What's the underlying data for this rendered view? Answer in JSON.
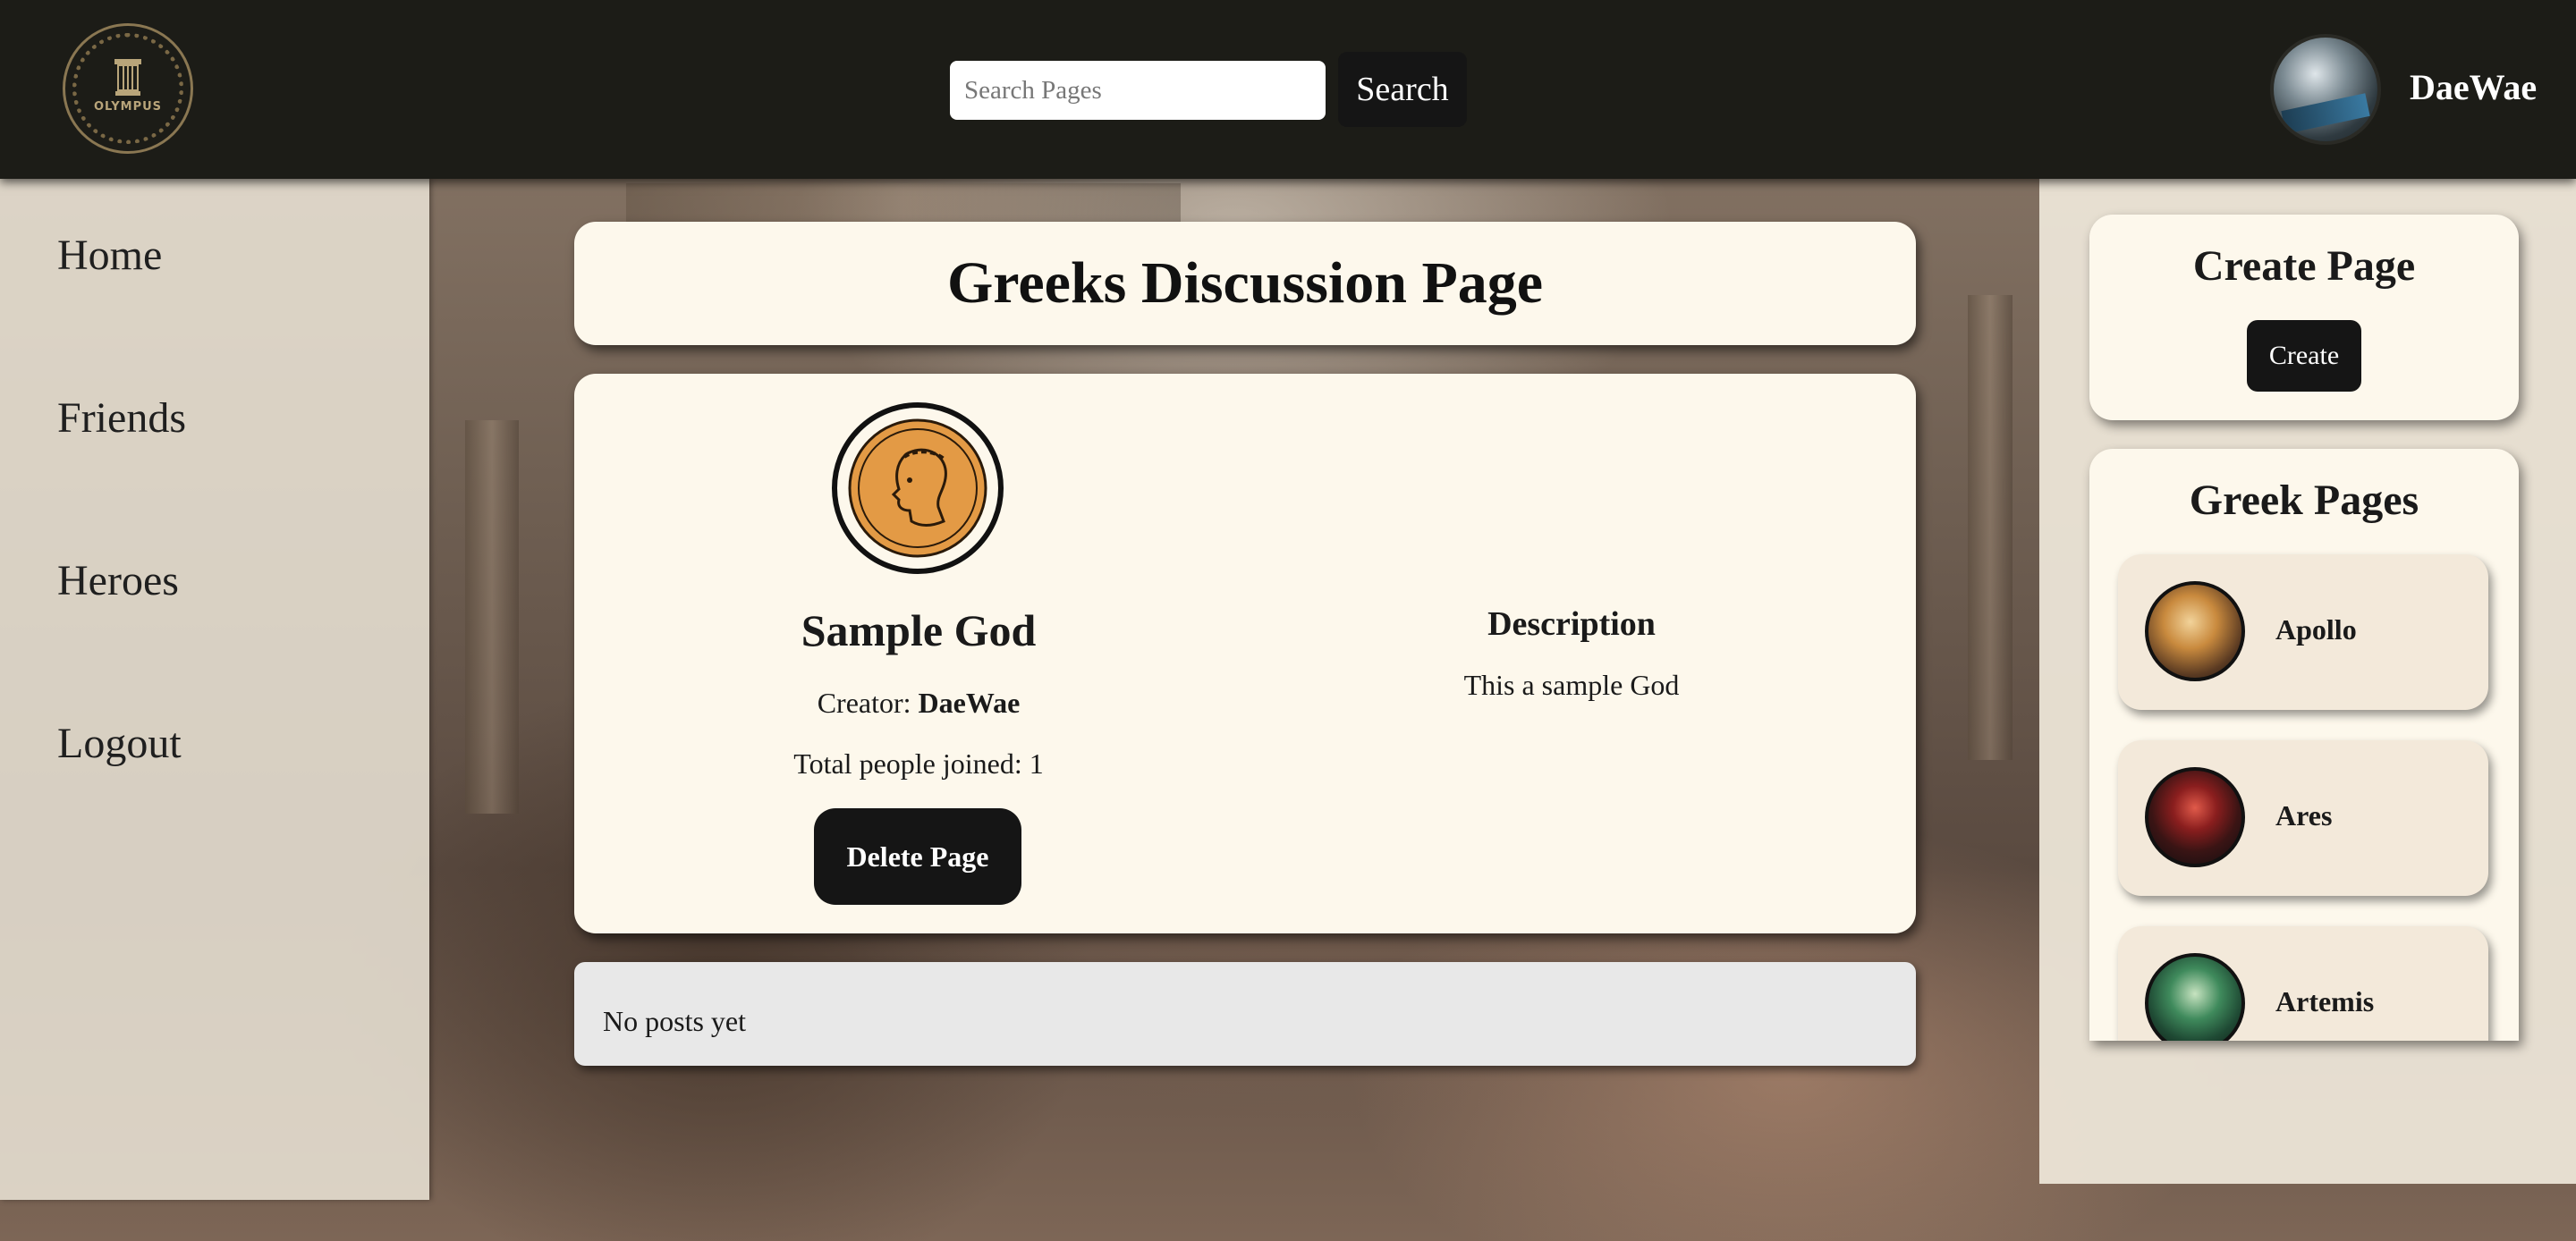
{
  "header": {
    "logo_text": "OLYMPUS",
    "search_placeholder": "Search Pages",
    "search_button": "Search",
    "username": "DaeWae"
  },
  "nav": {
    "items": [
      {
        "label": "Home"
      },
      {
        "label": "Friends"
      },
      {
        "label": "Heroes"
      },
      {
        "label": "Logout"
      }
    ]
  },
  "main": {
    "title": "Greeks Discussion Page",
    "god": {
      "name": "Sample God",
      "creator_prefix": "Creator: ",
      "creator": "DaeWae",
      "joined_label": "Total people joined: 1",
      "delete_button": "Delete Page"
    },
    "description": {
      "heading": "Description",
      "text": "This a sample God"
    },
    "posts_empty": "No posts yet"
  },
  "sidebar": {
    "create_title": "Create Page",
    "create_button": "Create",
    "pages_title": "Greek Pages",
    "pages": [
      {
        "name": "Apollo"
      },
      {
        "name": "Ares"
      },
      {
        "name": "Artemis"
      }
    ]
  },
  "colors": {
    "topbar": "#1c1c17",
    "card": "#fdf8ec",
    "button": "#151515",
    "coin": "#e39a45"
  }
}
